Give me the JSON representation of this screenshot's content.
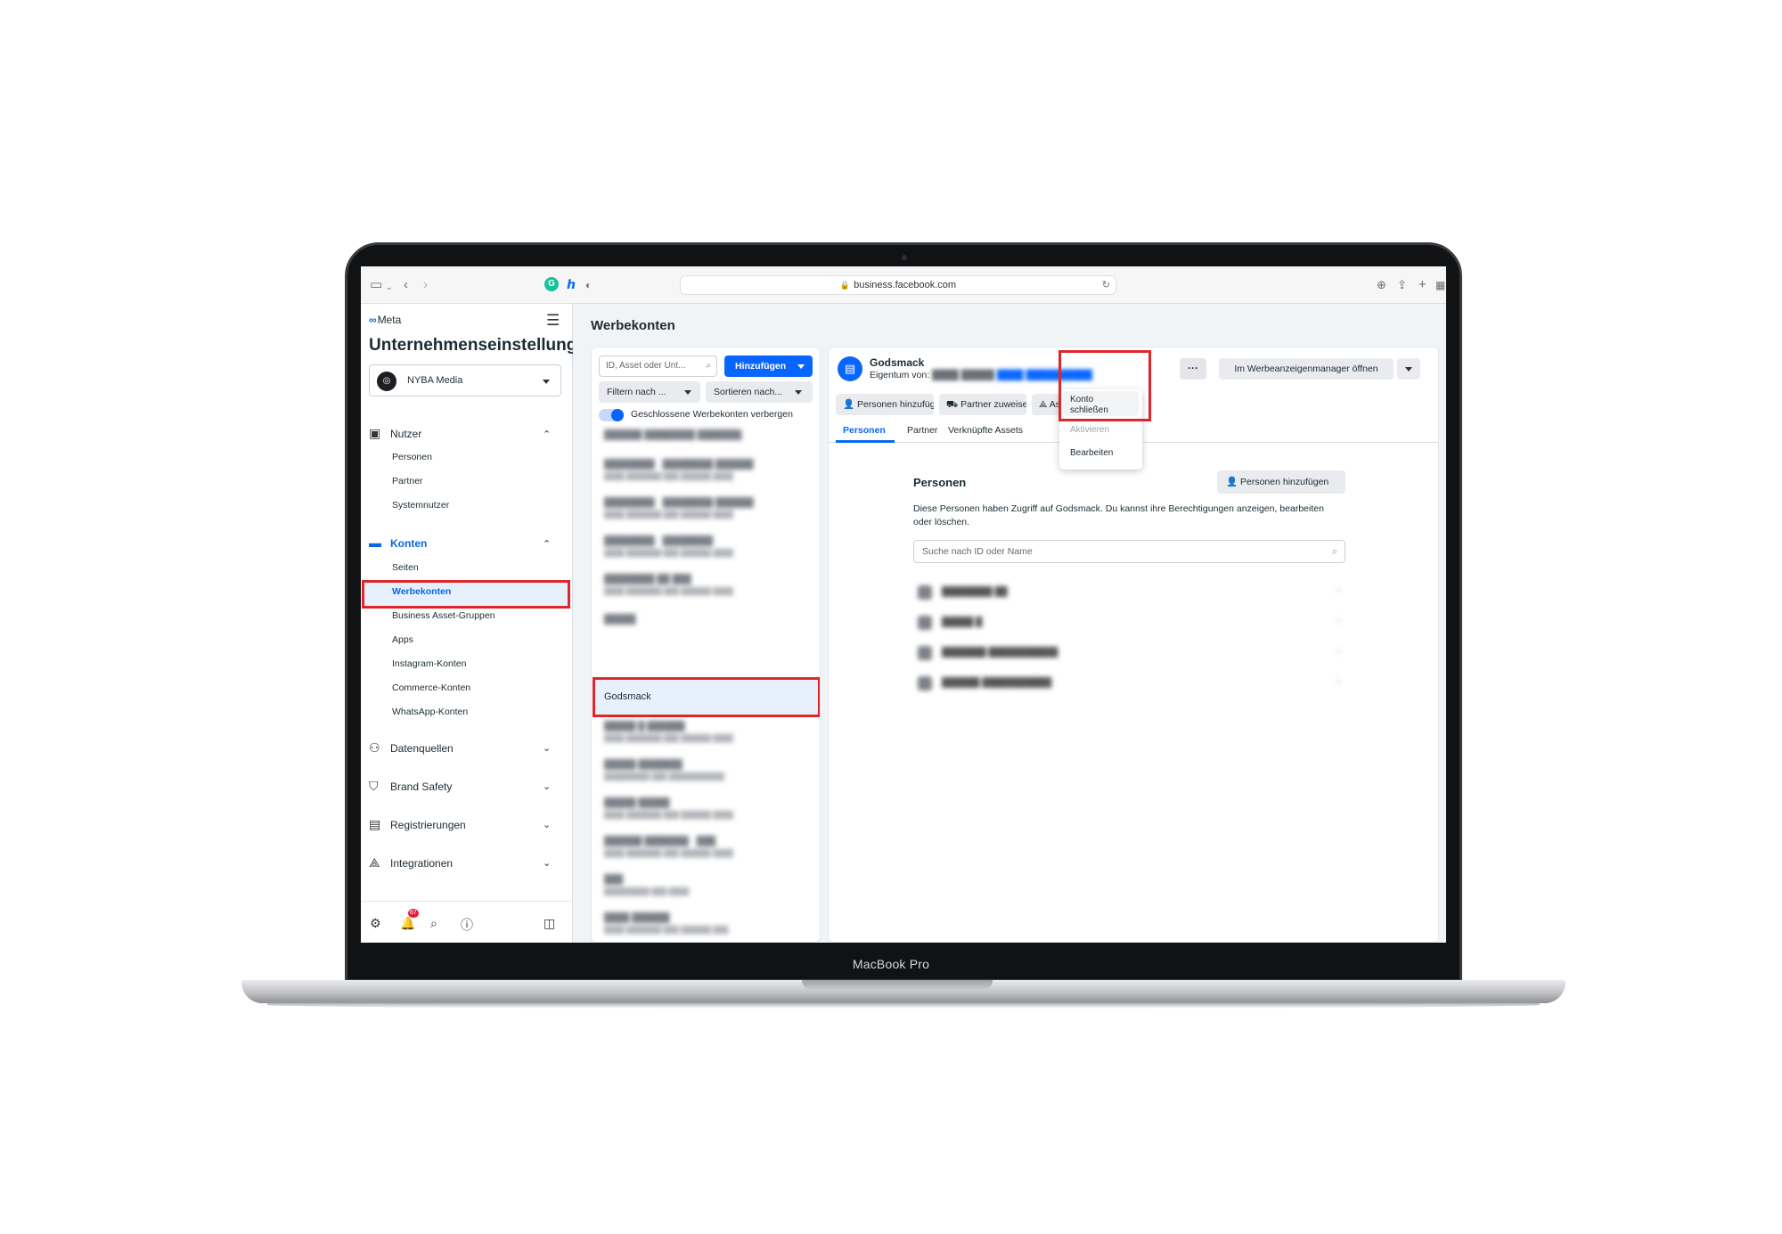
{
  "device": {
    "label": "MacBook Pro"
  },
  "browser": {
    "url": "business.facebook.com",
    "icons": [
      "sidebar-toggle-icon",
      "back-icon",
      "forward-icon",
      "shield-icon",
      "reload-icon",
      "download-icon",
      "share-icon",
      "new-tab-icon",
      "tab-overview-icon"
    ]
  },
  "sidebar": {
    "logo": "Meta",
    "title": "Unternehmenseinstellungen",
    "business": "NYBA Media",
    "sections": {
      "nutzer": {
        "label": "Nutzer",
        "items": [
          "Personen",
          "Partner",
          "Systemnutzer"
        ]
      },
      "konten": {
        "label": "Konten",
        "items": [
          "Seiten",
          "Werbekonten",
          "Business Asset-Gruppen",
          "Apps",
          "Instagram-Konten",
          "Commerce-Konten",
          "WhatsApp-Konten"
        ]
      },
      "datenquellen": {
        "label": "Datenquellen"
      },
      "brand_safety": {
        "label": "Brand Safety"
      },
      "registrierungen": {
        "label": "Registrierungen"
      },
      "integrationen": {
        "label": "Integrationen"
      }
    },
    "notification_count": "67"
  },
  "main": {
    "title": "Werbekonten",
    "list": {
      "search_placeholder": "ID, Asset oder Unt...",
      "add_button": "Hinzufügen",
      "filter_button": "Filtern nach ...",
      "sort_button": "Sortieren nach...",
      "toggle_label": "Geschlossene Werbekonten verbergen",
      "selected_item": "Godsmack"
    },
    "detail": {
      "account_name": "Godsmack",
      "owner_label": "Eigentum von:",
      "more_button": "···",
      "open_button": "Im Werbeanzeigenmanager öffnen",
      "actions": {
        "add_people": "Personen hinzufügen",
        "assign_partner": "Partner zuweisen",
        "assets": "Assets"
      },
      "tabs": [
        "Personen",
        "Partner",
        "Verknüpfte Assets"
      ],
      "dropdown": {
        "close": "Konto schließen",
        "activate": "Aktivieren",
        "edit": "Bearbeiten"
      },
      "people": {
        "title": "Personen",
        "add_button": "Personen hinzufügen",
        "description": "Diese Personen haben Zugriff auf Godsmack. Du kannst ihre Berechtigungen anzeigen, bearbeiten oder löschen.",
        "search_placeholder": "Suche nach ID oder Name"
      }
    }
  },
  "colors": {
    "accent": "#0866ff",
    "highlight": "#e0262a"
  }
}
